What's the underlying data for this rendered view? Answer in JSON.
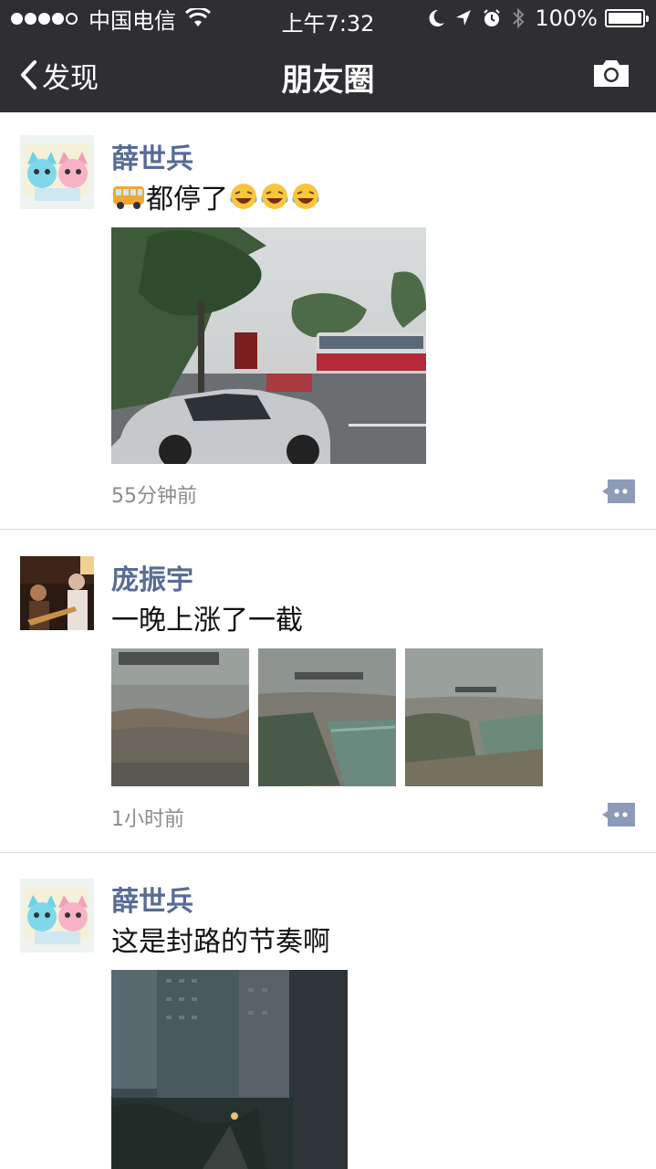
{
  "status_bar": {
    "carrier": "中国电信",
    "time": "上午7:32",
    "battery": "100%",
    "battery_level": 1.0,
    "signal_dots": 4,
    "icons": [
      "wifi-icon",
      "moon-icon",
      "location-arrow-icon",
      "alarm-icon",
      "bluetooth-icon",
      "battery-icon"
    ]
  },
  "nav": {
    "back_label": "发现",
    "title": "朋友圈",
    "right_icon": "camera-icon"
  },
  "posts": [
    {
      "name": "薛世兵",
      "text": "都停了",
      "emoji": [
        "bus-emoji",
        "laughing-tears-emoji",
        "laughing-tears-emoji",
        "laughing-tears-emoji"
      ],
      "time": "55分钟前",
      "photo_count": 1
    },
    {
      "name": "庞振宇",
      "text": "一晚上涨了一截",
      "time": "1小时前",
      "photo_count": 3
    },
    {
      "name": "薛世兵",
      "text": "这是封路的节奏啊",
      "photo_count": 1
    }
  ],
  "colors": {
    "header_bg": "#2f2e32",
    "name_blue": "#576b95",
    "time_gray": "#8b8b8b",
    "comment_btn": "#8e9bb8"
  }
}
